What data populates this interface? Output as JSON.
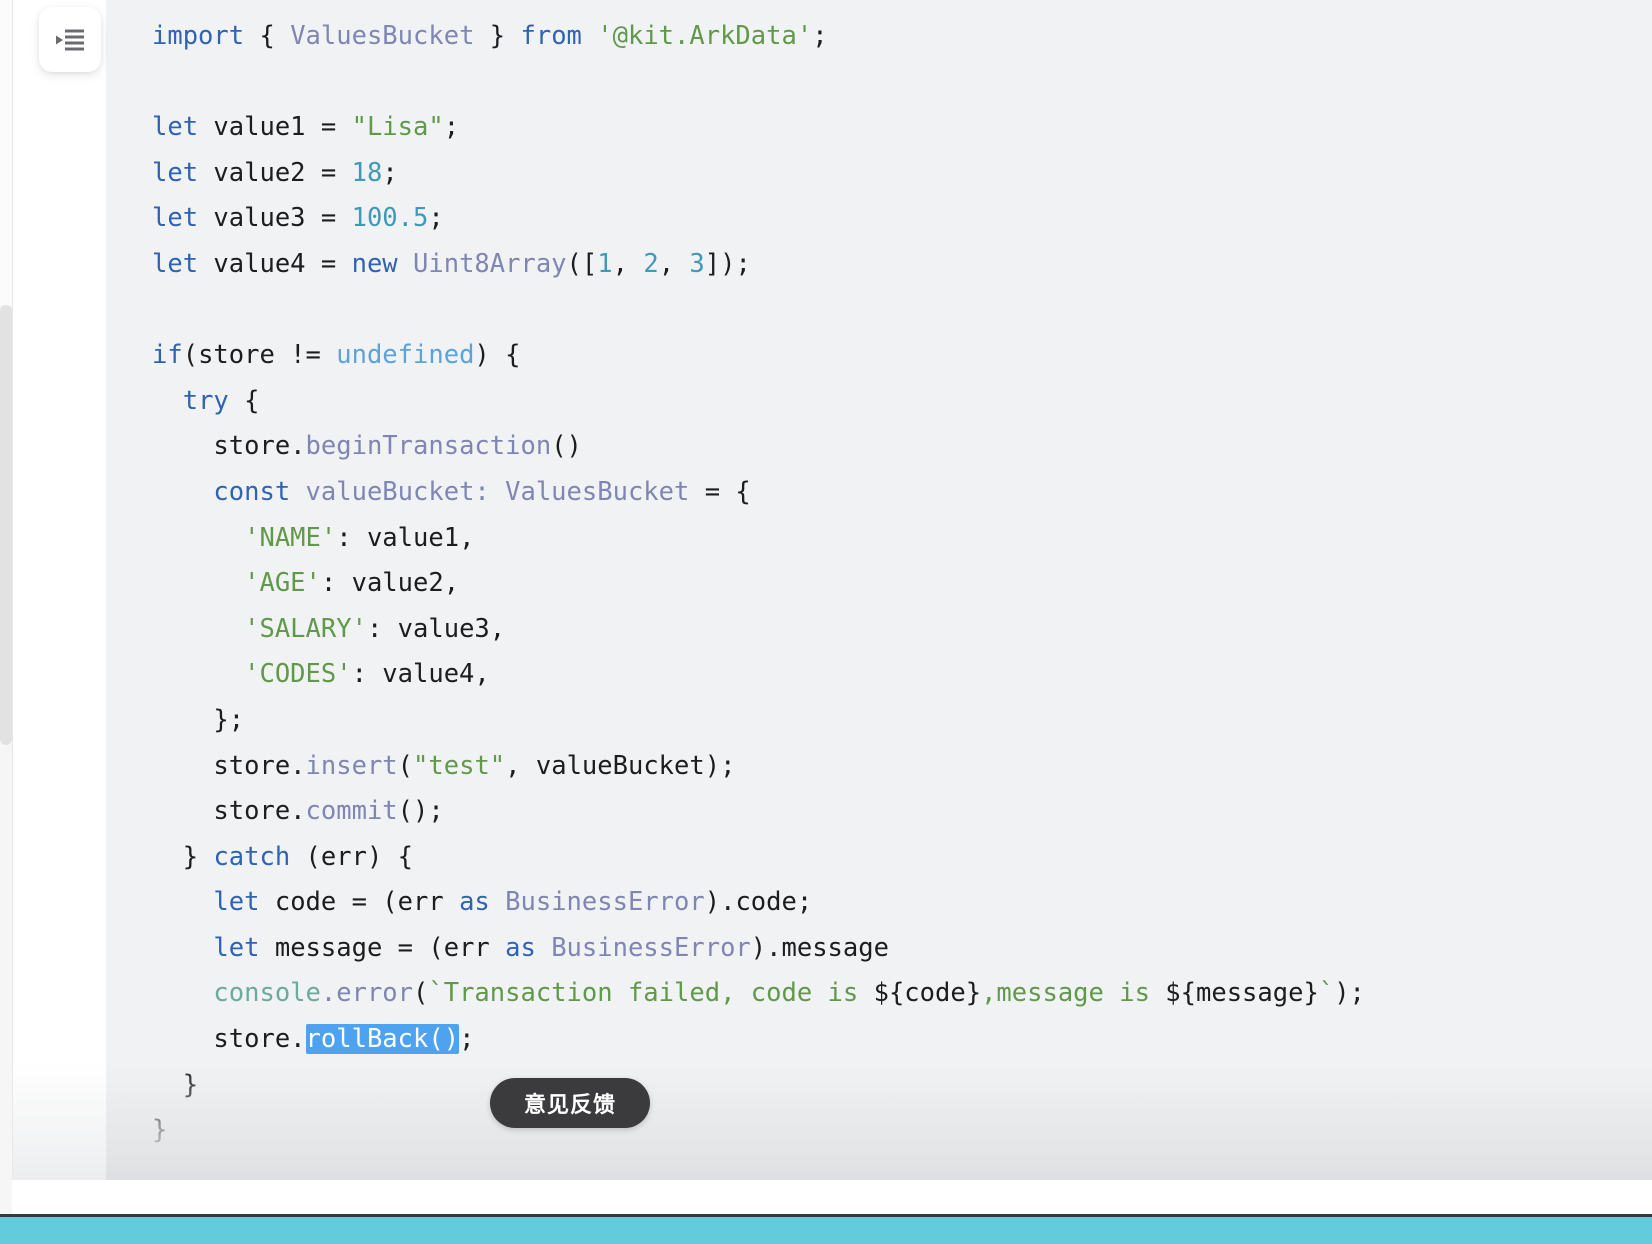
{
  "sidebar": {
    "toggle_icon": "collapse-sidebar-icon",
    "toggle_label": ""
  },
  "scrollbar": {
    "name": "vertical-scrollbar"
  },
  "code": {
    "language": "ArkTS",
    "selection": "rollBack()",
    "selection_color": "#4da3f0",
    "background_color": "#f1f2f4",
    "lines": [
      "import { ValuesBucket } from '@kit.ArkData';",
      "",
      "let value1 = \"Lisa\";",
      "let value2 = 18;",
      "let value3 = 100.5;",
      "let value4 = new Uint8Array([1, 2, 3]);",
      "",
      "if(store != undefined) {",
      "  try {",
      "    store.beginTransaction()",
      "    const valueBucket: ValuesBucket = {",
      "      'NAME': value1,",
      "      'AGE': value2,",
      "      'SALARY': value3,",
      "      'CODES': value4,",
      "    };",
      "    store.insert(\"test\", valueBucket);",
      "    store.commit();",
      "  } catch (err) {",
      "    let code = (err as BusinessError).code;",
      "    let message = (err as BusinessError).message",
      "    console.error(`Transaction failed, code is ${code},message is ${message}`);",
      "    store.rollBack();",
      "  }",
      "}"
    ],
    "tokens": {
      "l1": {
        "import": "import",
        "open_brace": " { ",
        "type": "ValuesBucket",
        "close_brace": " } ",
        "from": "from",
        "module": " '@kit.ArkData'",
        "semi": ";"
      },
      "l3": {
        "kw": "let",
        "name": " value1 = ",
        "str": "\"Lisa\"",
        "semi": ";"
      },
      "l4": {
        "kw": "let",
        "name": " value2 = ",
        "num": "18",
        "semi": ";"
      },
      "l5": {
        "kw": "let",
        "name": " value3 = ",
        "num": "100.5",
        "semi": ";"
      },
      "l6": {
        "kw": "let",
        "name": " value4 = ",
        "new": "new",
        "type": " Uint8Array",
        "open": "([",
        "n1": "1",
        "c1": ", ",
        "n2": "2",
        "c2": ", ",
        "n3": "3",
        "close": "]);"
      },
      "l8": {
        "if": "if",
        "cond": "(store != ",
        "undefined": "undefined",
        "tail": ") {"
      },
      "l9": {
        "try": "try",
        "tail": " {"
      },
      "l10": {
        "obj": "store.",
        "fn": "beginTransaction",
        "tail": "()"
      },
      "l11": {
        "kw": "const",
        "name": " valueBucket: ",
        "type": "ValuesBucket",
        "tail": " = {"
      },
      "l12": {
        "key": "'NAME'",
        "val": ": value1,"
      },
      "l13": {
        "key": "'AGE'",
        "val": ": value2,"
      },
      "l14": {
        "key": "'SALARY'",
        "val": ": value3,"
      },
      "l15": {
        "key": "'CODES'",
        "val": ": value4,"
      },
      "l16": {
        "text": "};"
      },
      "l17": {
        "obj": "store.",
        "fn": "insert",
        "open": "(",
        "str": "\"test\"",
        "tail": ", valueBucket);"
      },
      "l18": {
        "obj": "store.",
        "fn": "commit",
        "tail": "();"
      },
      "l19": {
        "brace": "} ",
        "catch": "catch",
        "tail": " (err) {"
      },
      "l20": {
        "kw": "let",
        "mid": " code = (err ",
        "as": "as",
        "type": " BusinessError",
        "tail": ").code;"
      },
      "l21": {
        "kw": "let",
        "mid": " message = (err ",
        "as": "as",
        "type": " BusinessError",
        "tail": ").message"
      },
      "l22": {
        "console": "console",
        "dot_error": ".error",
        "open": "(",
        "tpl1": "`Transaction failed, code is ",
        "expr1": "${code}",
        "tpl2": ",message is ",
        "expr2": "${message}",
        "tpl3": "`",
        "close": ");"
      },
      "l23": {
        "obj": "store.",
        "sel": "rollBack()",
        "semi": ";"
      },
      "l24": {
        "text": "}"
      },
      "l25": {
        "text": "}"
      }
    }
  },
  "feedback_button": {
    "label": "意见反馈",
    "background_color": "#3b3b3d",
    "text_color": "#ffffff"
  },
  "bottom_bar": {
    "color": "#63cbdc"
  }
}
